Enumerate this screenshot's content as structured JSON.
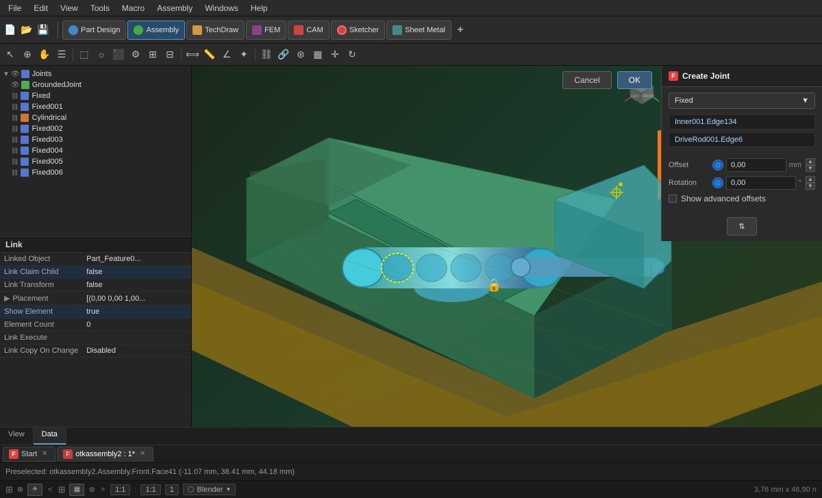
{
  "menubar": {
    "items": [
      "File",
      "Edit",
      "View",
      "Tools",
      "Macro",
      "Assembly",
      "Windows",
      "Help"
    ]
  },
  "toolbar": {
    "workbenches": [
      {
        "label": "Part Design",
        "color": "#4488cc",
        "active": false
      },
      {
        "label": "Assembly",
        "color": "#44aa44",
        "active": true
      },
      {
        "label": "TechDraw",
        "color": "#888844",
        "active": false
      },
      {
        "label": "FEM",
        "color": "#884488",
        "active": false
      },
      {
        "label": "CAM",
        "color": "#cc4444",
        "active": false
      },
      {
        "label": "Sketcher",
        "color": "#cc4444",
        "active": false
      },
      {
        "label": "Sheet Metal",
        "color": "#448888",
        "active": false
      }
    ],
    "add_label": "+"
  },
  "tree": {
    "items": [
      {
        "indent": 0,
        "label": "Joints",
        "type": "folder",
        "expanded": true
      },
      {
        "indent": 1,
        "label": "GroundedJoint",
        "type": "grounded"
      },
      {
        "indent": 1,
        "label": "Fixed",
        "type": "fixed"
      },
      {
        "indent": 1,
        "label": "Fixed001",
        "type": "fixed"
      },
      {
        "indent": 1,
        "label": "Cylindrical",
        "type": "cylindrical"
      },
      {
        "indent": 1,
        "label": "Fixed002",
        "type": "fixed"
      },
      {
        "indent": 1,
        "label": "Fixed003",
        "type": "fixed"
      },
      {
        "indent": 1,
        "label": "Fixed004",
        "type": "fixed"
      },
      {
        "indent": 1,
        "label": "Fixed005",
        "type": "fixed"
      },
      {
        "indent": 1,
        "label": "Fixed006",
        "type": "fixed"
      }
    ]
  },
  "properties": {
    "header": "Link",
    "rows": [
      {
        "label": "Linked Object",
        "value": "Part_Feature0...",
        "selected": false
      },
      {
        "label": "Link Claim Child",
        "value": "false",
        "selected": true
      },
      {
        "label": "Link Transform",
        "value": "false",
        "selected": false
      },
      {
        "label": "Placement",
        "value": "[(0,00 0,00 1,00...",
        "selected": false,
        "arrow": true
      },
      {
        "label": "Show Element",
        "value": "true",
        "selected": true
      },
      {
        "label": "Element Count",
        "value": "0",
        "selected": false
      },
      {
        "label": "Link Execute",
        "value": "",
        "selected": false
      },
      {
        "label": "Link Copy On Change",
        "value": "Disabled",
        "selected": false
      }
    ]
  },
  "panel_tabs": [
    "View",
    "Data"
  ],
  "create_joint": {
    "title": "Create Joint",
    "joint_type": "Fixed",
    "edge1": "Inner001.Edge134",
    "edge2": "DriveRod001.Edge6",
    "offset_label": "Offset",
    "offset_value": "0,00",
    "offset_unit": "mm",
    "rotation_label": "Rotation",
    "rotation_value": "0,00",
    "rotation_unit": "°",
    "show_advanced": "Show advanced offsets",
    "icon_btn_label": "⇅"
  },
  "action_buttons": {
    "cancel": "Cancel",
    "ok": "OK"
  },
  "tabs": [
    {
      "label": "Start",
      "closable": true,
      "icon": "F",
      "active": false
    },
    {
      "label": "otkassembly2 : 1*",
      "closable": true,
      "icon": "FC",
      "active": true
    }
  ],
  "statusbar": {
    "preselected": "Preselected: otkassembly2.Assembly.Front.Face41 (-11.07 mm, 38.41 mm, 44.18 mm)"
  },
  "bottombar": {
    "zoom_level": "1:1",
    "zoom_fit": "1:1",
    "page_num": "1",
    "renderer": "Blender",
    "dimensions": "3,76 mm x 46,90 n"
  }
}
